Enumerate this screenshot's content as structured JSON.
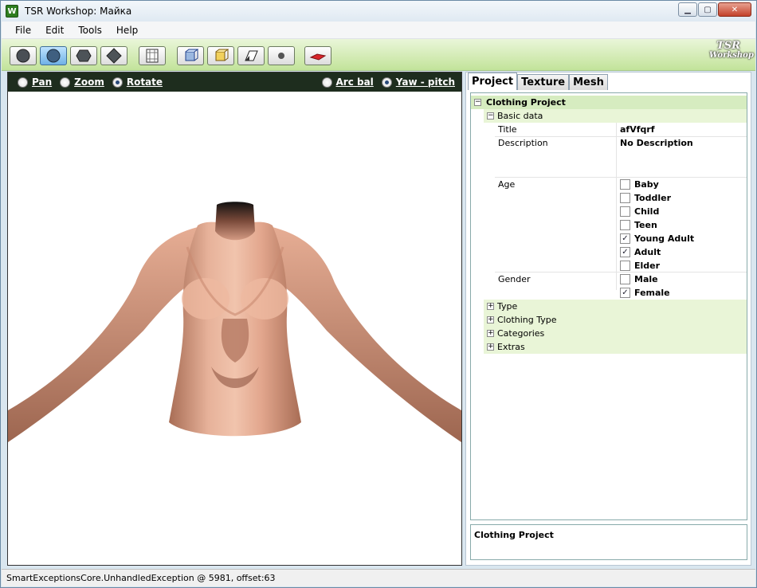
{
  "window": {
    "title": "TSR Workshop: Майка",
    "icon_letter": "W"
  },
  "menu": [
    "File",
    "Edit",
    "Tools",
    "Help"
  ],
  "toolbar": {
    "buttons": [
      {
        "icon": "sphere-icon"
      },
      {
        "icon": "sphere-shaded-icon"
      },
      {
        "icon": "hexagon-icon"
      },
      {
        "icon": "diamond-icon"
      },
      {
        "icon": "frame-icon"
      },
      {
        "icon": "cube-bones-icon"
      },
      {
        "icon": "cube-yellow-icon"
      },
      {
        "icon": "plane-icon"
      },
      {
        "icon": "dot-icon"
      },
      {
        "icon": "red-shape-icon"
      }
    ],
    "logo_line1": "TSR",
    "logo_line2": "Workshop"
  },
  "viewport": {
    "modes": [
      {
        "label": "Pan",
        "selected": false
      },
      {
        "label": "Zoom",
        "selected": false
      },
      {
        "label": "Rotate",
        "selected": true
      }
    ],
    "orbit": [
      {
        "label": "Arc bal",
        "selected": false
      },
      {
        "label": "Yaw - pitch",
        "selected": true
      }
    ]
  },
  "tabs": [
    "Project",
    "Texture",
    "Mesh"
  ],
  "tree": {
    "root": "Clothing Project",
    "basic_data": "Basic data",
    "title_label": "Title",
    "title_value": "afVfqrf",
    "description_label": "Description",
    "description_value": "No Description",
    "age_label": "Age",
    "ages": [
      {
        "label": "Baby",
        "checked": false
      },
      {
        "label": "Toddler",
        "checked": false
      },
      {
        "label": "Child",
        "checked": false
      },
      {
        "label": "Teen",
        "checked": false
      },
      {
        "label": "Young Adult",
        "checked": true
      },
      {
        "label": "Adult",
        "checked": true
      },
      {
        "label": "Elder",
        "checked": false
      }
    ],
    "gender_label": "Gender",
    "genders": [
      {
        "label": "Male",
        "checked": false
      },
      {
        "label": "Female",
        "checked": true
      }
    ],
    "collapsed": [
      "Type",
      "Clothing Type",
      "Categories",
      "Extras"
    ]
  },
  "description_panel": "Clothing Project",
  "status": "SmartExceptionsCore.UnhandledException @ 5981, offset:63"
}
